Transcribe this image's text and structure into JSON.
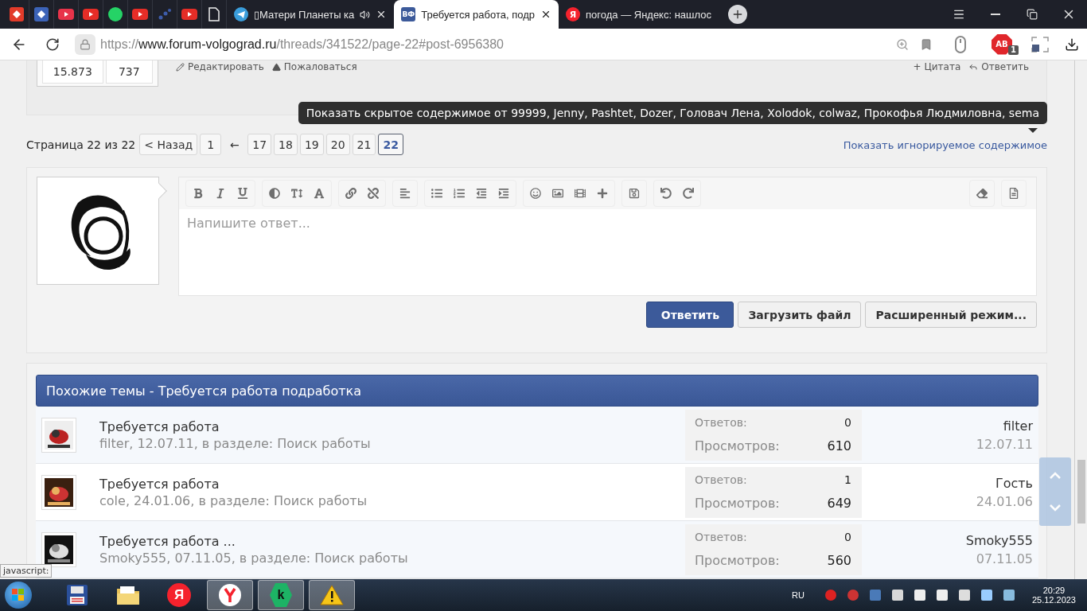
{
  "browser": {
    "tabs": [
      {
        "title": "▯Матери Планеты ка",
        "kind": "telegram",
        "sound": true,
        "selected": false
      },
      {
        "title": "Требуется работа, подр",
        "kind": "forum",
        "badge": "ВФ",
        "sound": false,
        "selected": true
      },
      {
        "title": "погода — Яндекс: нашлос",
        "kind": "yandex",
        "badge": "Я",
        "sound": false,
        "selected": false
      }
    ],
    "url": {
      "scheme": "https://",
      "host": "www.forum-volgograd.ru",
      "path": "/threads/341522/page-22#post-6956380"
    },
    "adblock": {
      "label": "AB",
      "count": "1"
    }
  },
  "post": {
    "stats": [
      "15.873",
      "737"
    ],
    "actions_left": [
      "Редактировать",
      "Пожаловаться"
    ],
    "actions_right": [
      "+ Цитата",
      "Ответить"
    ]
  },
  "tooltip": "Показать скрытое содержимое от 99999, Jenny, Pashtet, Dozer, Головач Лена, Xolodok, colwaz, Прокофья Людмиловна, sema",
  "pagination": {
    "label": "Страница 22 из 22",
    "items": [
      {
        "label": "< Назад",
        "kind": "page",
        "selected": false
      },
      {
        "label": "1",
        "kind": "page",
        "selected": false
      },
      {
        "label": "←",
        "kind": "skip",
        "selected": false
      },
      {
        "label": "17",
        "kind": "page",
        "selected": false
      },
      {
        "label": "18",
        "kind": "page",
        "selected": false
      },
      {
        "label": "19",
        "kind": "page",
        "selected": false
      },
      {
        "label": "20",
        "kind": "page",
        "selected": false
      },
      {
        "label": "21",
        "kind": "page",
        "selected": false
      },
      {
        "label": "22",
        "kind": "page",
        "selected": true
      }
    ]
  },
  "ignored_link": "Показать игнорируемое содержимое",
  "editor": {
    "placeholder": "Напишите ответ...",
    "buttons": [
      {
        "label": "Ответить",
        "kind": "primary"
      },
      {
        "label": "Загрузить файл",
        "kind": "secondary"
      },
      {
        "label": "Расширенный режим...",
        "kind": "secondary"
      }
    ]
  },
  "similar": {
    "title": "Похожие темы - Требуется работа подработка",
    "threads": [
      {
        "title": "Требуется работа",
        "meta": "filter, 12.07.11, в разделе: Поиск работы",
        "replies_label": "Ответов:",
        "replies": "0",
        "views_label": "Просмотров:",
        "views": "610",
        "last_user": "filter",
        "last_date": "12.07.11"
      },
      {
        "title": "Требуется работа",
        "meta": "cole, 24.01.06, в разделе: Поиск работы",
        "replies_label": "Ответов:",
        "replies": "1",
        "views_label": "Просмотров:",
        "views": "649",
        "last_user": "Гость",
        "last_date": "24.01.06"
      },
      {
        "title": "Требуется работа ...",
        "meta": "Smoky555, 07.11.05, в разделе: Поиск работы",
        "replies_label": "Ответов:",
        "replies": "0",
        "views_label": "Просмотров:",
        "views": "560",
        "last_user": "Smoky555",
        "last_date": "07.11.05"
      }
    ]
  },
  "status_text": "javascript:",
  "taskbar": {
    "apps": [
      {
        "kind": "floppy"
      },
      {
        "kind": "folder"
      },
      {
        "kind": "letter",
        "label": "Я",
        "selected": false
      },
      {
        "kind": "ybrowser",
        "selected": true
      },
      {
        "kind": "kaspersky",
        "label": "k",
        "selected": true
      },
      {
        "kind": "warning",
        "selected": true
      }
    ],
    "language": "RU",
    "time": "20:29",
    "date": "25.12.2023"
  }
}
